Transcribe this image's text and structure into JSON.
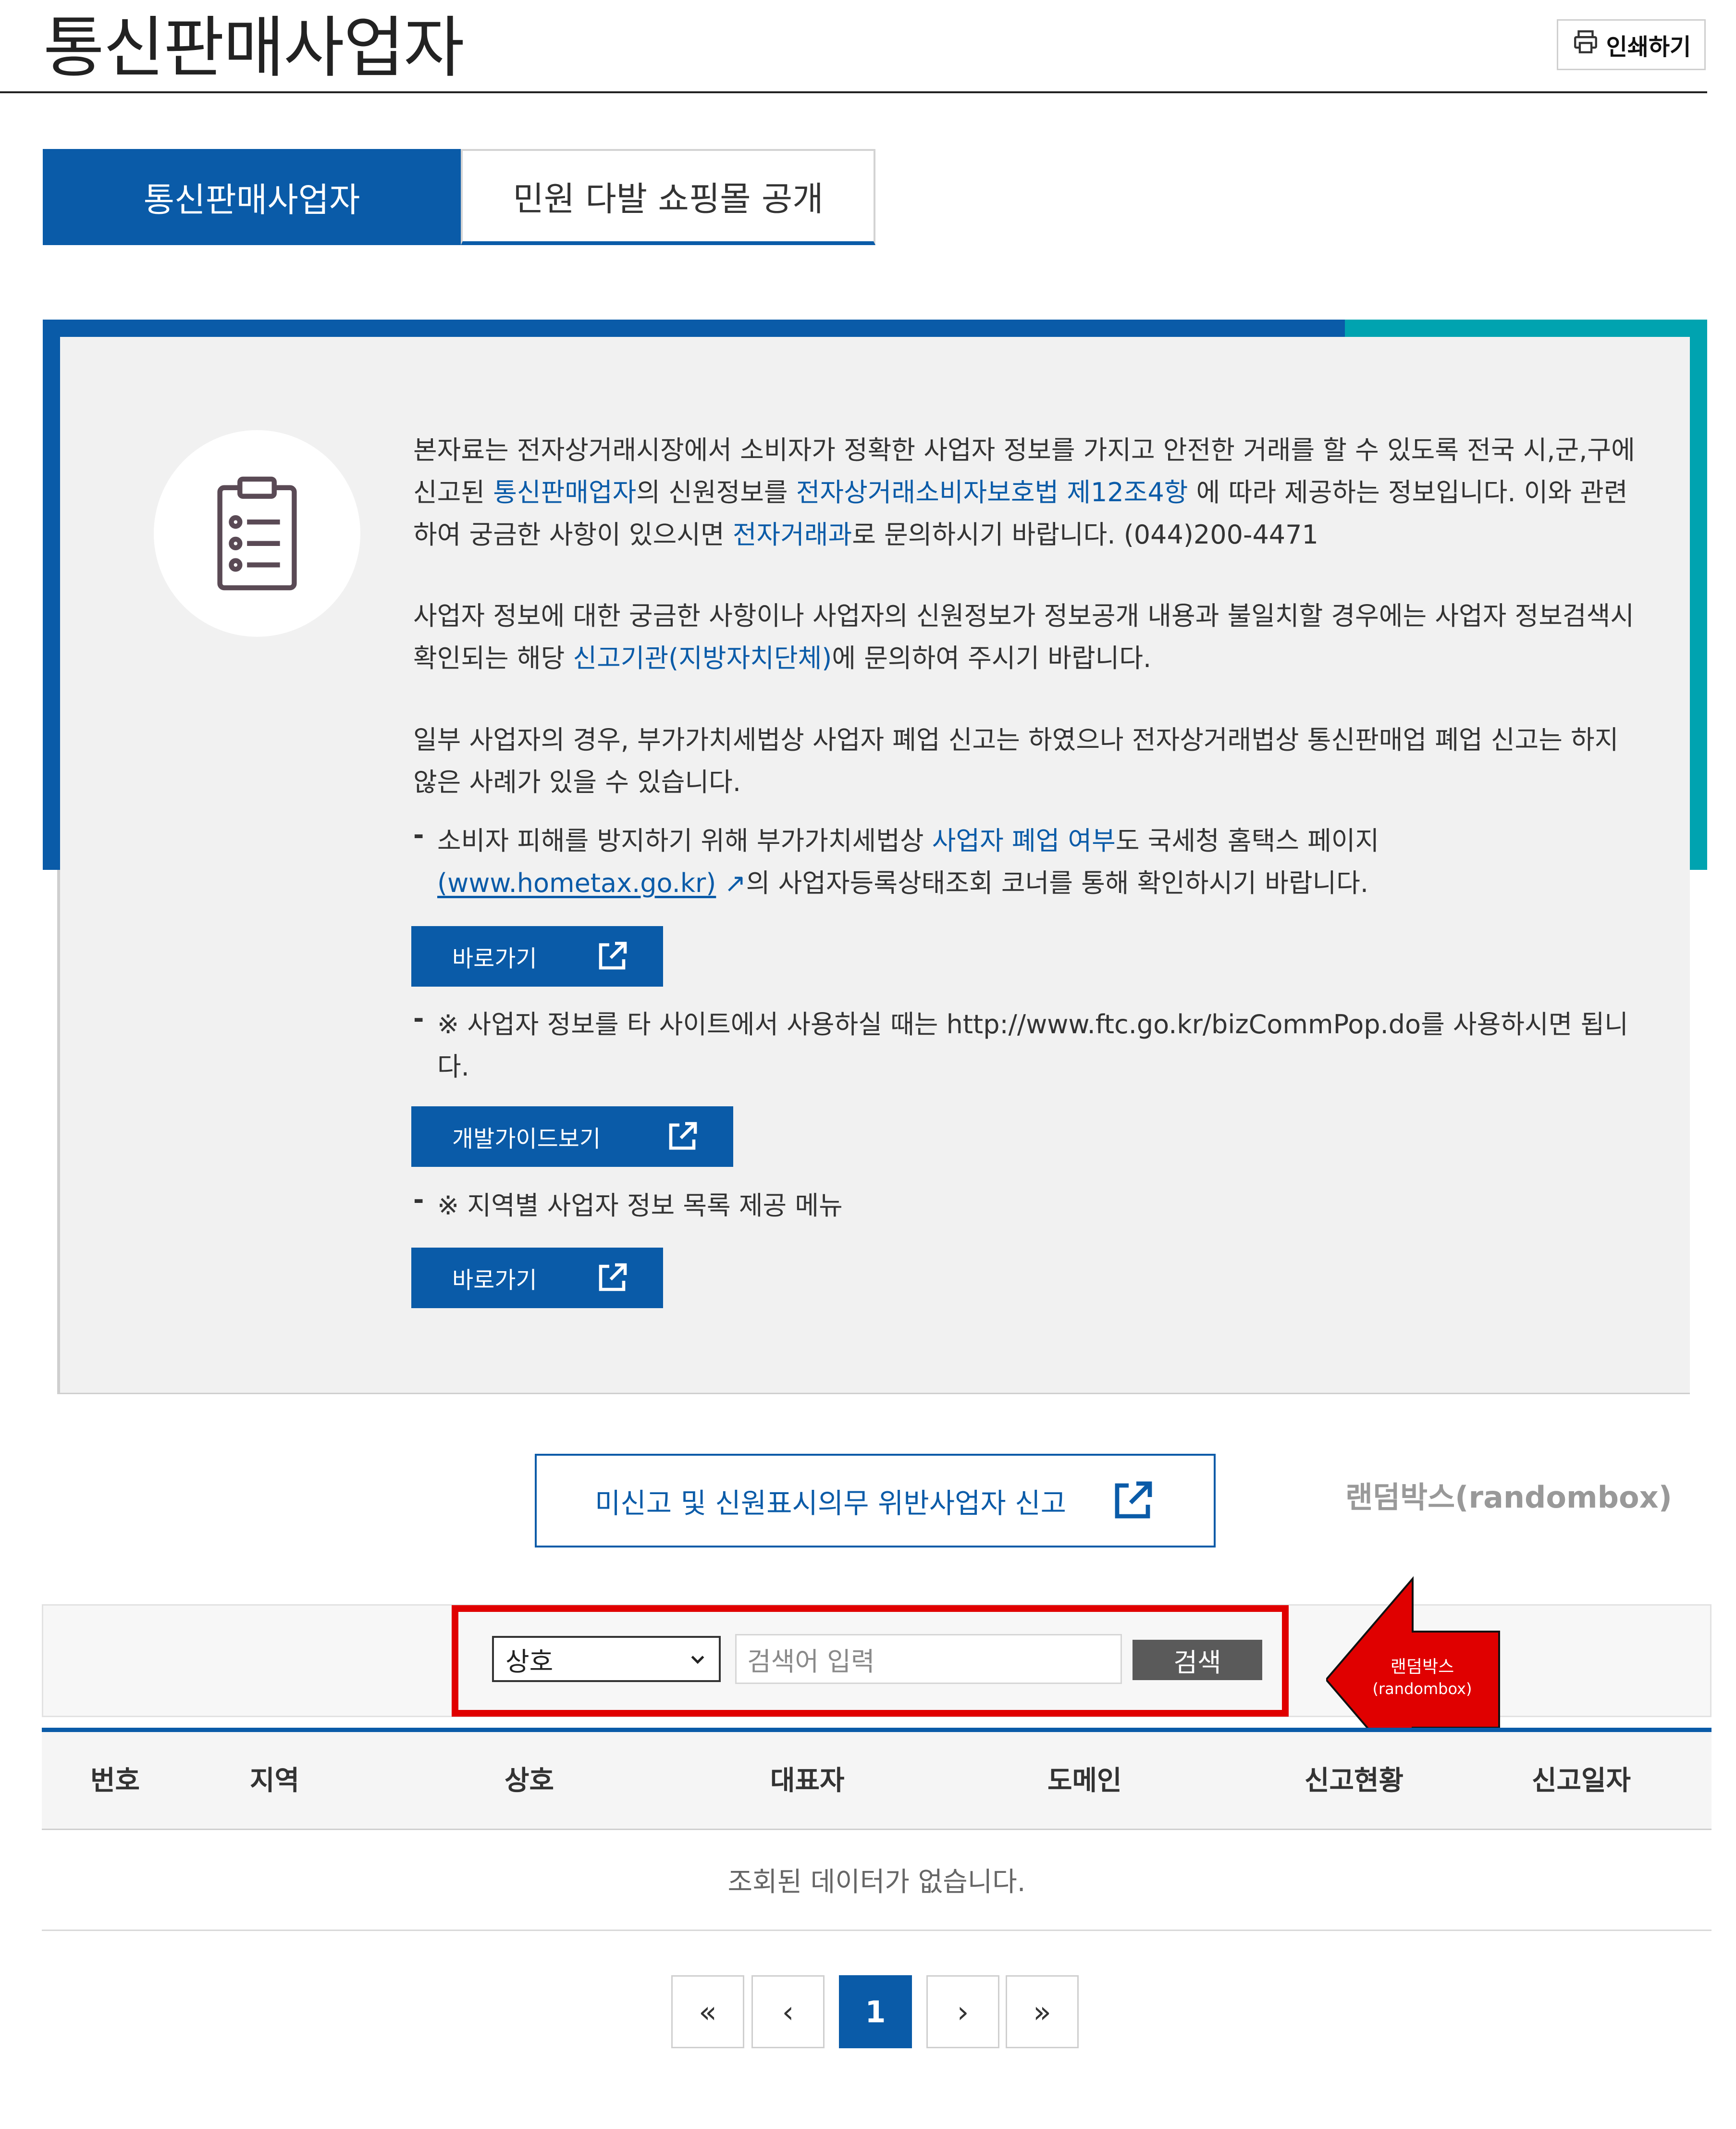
{
  "header": {
    "title": "통신판매사업자",
    "print_label": "인쇄하기"
  },
  "tabs": [
    {
      "label": "통신판매사업자",
      "active": true
    },
    {
      "label": "민원 다발 쇼핑몰 공개",
      "active": false
    }
  ],
  "info": {
    "p1": {
      "t1": "본자료는 전자상거래시장에서 소비자가 정확한 사업자 정보를 가지고 안전한 거래를 할 수 있도록 전국 시,군,구에 신고된 ",
      "l1": "통신판매업자",
      "t2": "의 신원정보를 ",
      "l2": "전자상거래소비자보호법 제12조4항",
      "t3": " 에 따라 제공하는 정보입니다. 이와 관련하여 궁금한 사항이 있으시면 ",
      "l3": "전자거래과",
      "t4": "로 문의하시기 바랍니다. (044)200-4471"
    },
    "p2": {
      "t1": "사업자 정보에 대한 궁금한 사항이나 사업자의 신원정보가 정보공개 내용과 불일치할 경우에는 사업자 정보검색시 확인되는 해당 ",
      "l1": "신고기관(지방자치단체)",
      "t2": "에 문의하여 주시기 바랍니다."
    },
    "p3": "일부 사업자의 경우, 부가가치세법상 사업자 폐업 신고는 하였으나 전자상거래법상 통신판매업 폐업 신고는 하지 않은 사례가 있을 수 있습니다.",
    "bullet1": {
      "t1": "소비자 피해를 방지하기 위해 부가가치세법상 ",
      "l1": "사업자 폐업 여부",
      "t2": "도 국세청 홈택스 페이지",
      "l2": "(www.hometax.go.kr)",
      "t3": "의 사업자등록상태조회 코너를 통해 확인하시기 바랍니다."
    },
    "btn_goto_1": "바로가기",
    "bullet2": "※ 사업자 정보를 타 사이트에서 사용하실 때는 http://www.ftc.go.kr/bizCommPop.do를 사용하시면 됩니다.",
    "btn_guide": "개발가이드보기",
    "bullet3": "※ 지역별 사업자 정보 목록 제공 메뉴",
    "btn_goto_2": "바로가기",
    "dash": "-"
  },
  "report_button": "미신고 및 신원표시의무 위반사업자 신고",
  "randombox_label": "랜덤박스(randombox)",
  "search": {
    "select_value": "상호",
    "placeholder": "검색어 입력",
    "button": "검색"
  },
  "annotation": {
    "line1": "랜덤박스",
    "line2": "(randombox)",
    "color": "#e00000"
  },
  "table": {
    "headers": [
      "번호",
      "지역",
      "상호",
      "대표자",
      "도메인",
      "신고현황",
      "신고일자"
    ],
    "empty_message": "조회된 데이터가 없습니다."
  },
  "pagination": {
    "first": "«",
    "prev": "‹",
    "current": "1",
    "next": "›",
    "last": "»"
  },
  "colors": {
    "primary": "#0a5ba8",
    "teal": "#00a3b0",
    "highlight": "#e00000"
  }
}
